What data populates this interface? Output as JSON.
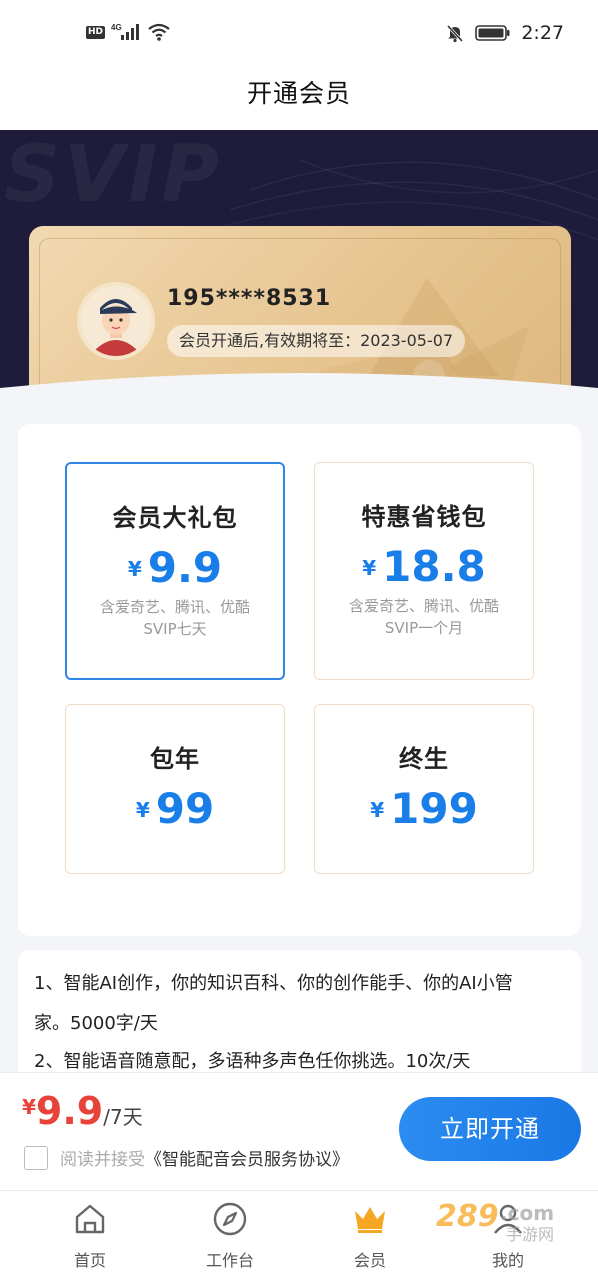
{
  "status_bar": {
    "hd": "HD",
    "network": "4G",
    "time": "2:27"
  },
  "nav": {
    "title": "开通会员"
  },
  "hero": {
    "bg_text": "SVIP",
    "phone": "195****8531",
    "expire": "会员开通后,有效期将至：2023-05-07"
  },
  "plans": [
    {
      "name": "会员大礼包",
      "currency": "¥",
      "price": "9.9",
      "desc_line1": "含爱奇艺、腾讯、优酷",
      "desc_line2": "SVIP七天",
      "selected": true
    },
    {
      "name": "特惠省钱包",
      "currency": "¥",
      "price": "18.8",
      "desc_line1": "含爱奇艺、腾讯、优酷",
      "desc_line2": "SVIP一个月",
      "selected": false
    },
    {
      "name": "包年",
      "currency": "¥",
      "price": "99",
      "desc_line1": "",
      "desc_line2": "",
      "selected": false
    },
    {
      "name": "终生",
      "currency": "¥",
      "price": "199",
      "desc_line1": "",
      "desc_line2": "",
      "selected": false
    }
  ],
  "features": {
    "line1": "1、智能AI创作，你的知识百科、你的创作能手、你的AI小管",
    "line2": "家。5000字/天",
    "line3": "2、智能语音随意配，多语种多声色任你挑选。10次/天"
  },
  "purchase": {
    "currency": "¥",
    "price": "9.9",
    "period": "/7天",
    "agree_text": "阅读并接受",
    "agree_link": "《智能配音会员服务协议》",
    "button_label": "立即开通"
  },
  "tabs": [
    {
      "label": "首页",
      "icon": "home-icon"
    },
    {
      "label": "工作台",
      "icon": "compass-icon"
    },
    {
      "label": "会员",
      "icon": "crown-icon"
    },
    {
      "label": "我的",
      "icon": "user-icon"
    }
  ],
  "colors": {
    "accent_blue": "#1a7ee8",
    "price_red": "#e8433a",
    "gold": "#e6c48f",
    "crown_orange": "#f5a623"
  },
  "watermark": "289.com 手游网"
}
